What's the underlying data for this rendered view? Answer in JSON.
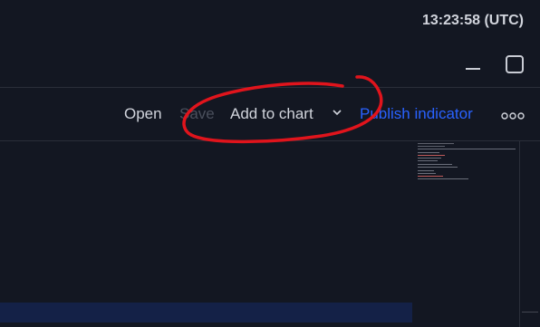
{
  "header": {
    "clock": "13:23:58 (UTC)"
  },
  "toolbar": {
    "open_label": "Open",
    "save_label": "Save",
    "add_to_chart_label": "Add to chart",
    "publish_label": "Publish indicator"
  },
  "icons": {
    "minimize": "minimize-icon",
    "maximize": "maximize-icon",
    "chevron": "chevron-down-icon",
    "more": "more-horizontal-icon"
  },
  "colors": {
    "background": "#131722",
    "text": "#d1d4dc",
    "disabled": "#4a4f5c",
    "accent": "#2962ff",
    "current_line": "#142147",
    "annotation": "#e0141c"
  }
}
